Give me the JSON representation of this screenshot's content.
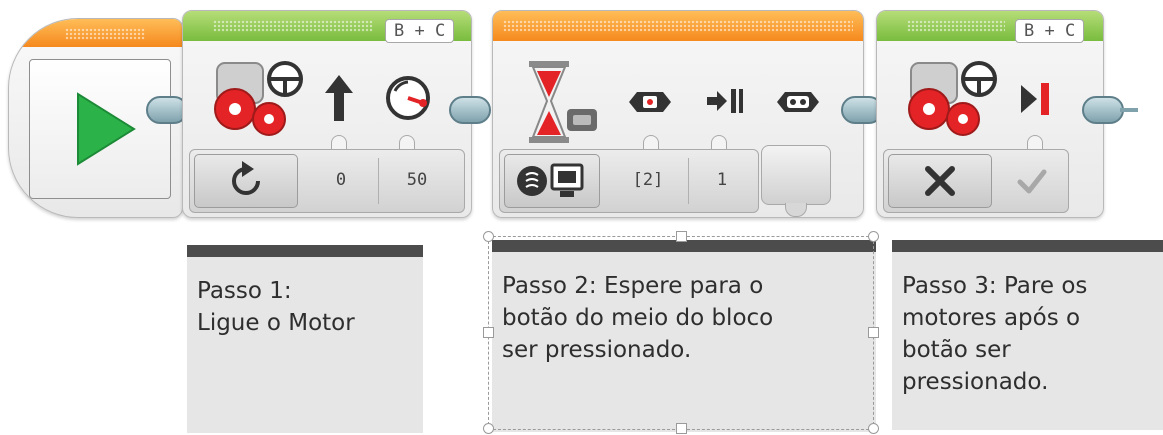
{
  "start_block": {
    "icon": "play-icon"
  },
  "block_motor_on": {
    "port": "B + C",
    "mode_icon": "rotate-arrow-icon",
    "params": [
      {
        "icon": "steering-arrow-up-icon",
        "value": "0"
      },
      {
        "icon": "speedometer-icon",
        "value": "50"
      }
    ]
  },
  "block_wait": {
    "mode_icon": "brick-buttons-mode-icon",
    "params": [
      {
        "icon": "brick-button-center-icon",
        "value": "[2]"
      },
      {
        "icon": "bump-icon",
        "value": "1"
      },
      {
        "icon": "brick-button-state-icon",
        "value": ""
      }
    ]
  },
  "block_motor_off": {
    "port": "B + C",
    "mode_icon": "close-x-icon",
    "params": [
      {
        "icon": "stop-icon",
        "value": "check"
      }
    ]
  },
  "comments": [
    {
      "text": "Passo 1:\nLigue o Motor"
    },
    {
      "text": "Passo 2: Espere para o\nbotão do meio do bloco\nser pressionado."
    },
    {
      "text": "Passo 3: Pare os\nmotores após o\nbotão ser\npressionado."
    }
  ],
  "colors": {
    "start_green": "#2bb34a",
    "action_green": "#8cc63f",
    "flow_orange": "#f7941d",
    "motor_red": "#e32325",
    "comment_bar": "#4c4c4c",
    "comment_bg": "#e6e6e6",
    "connector": "#7fa2ad"
  }
}
